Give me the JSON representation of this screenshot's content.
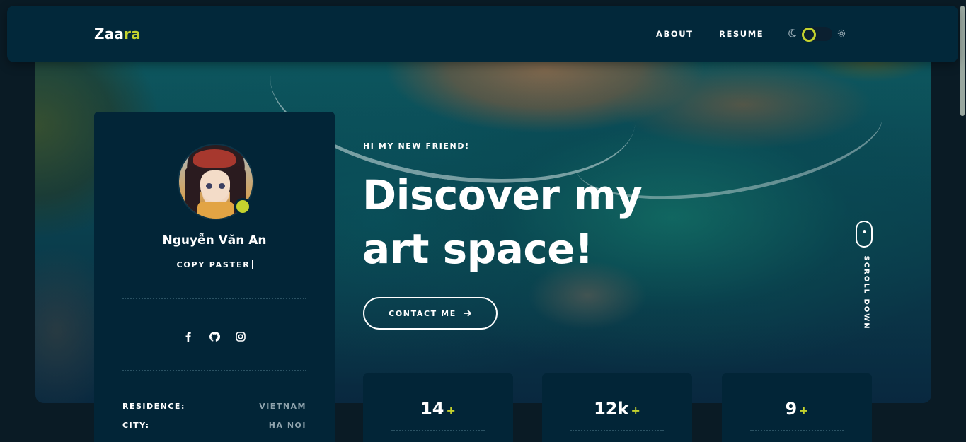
{
  "header": {
    "logo_main": "Zaa",
    "logo_accent": "ra",
    "nav": [
      {
        "label": "ABOUT"
      },
      {
        "label": "RESUME"
      }
    ],
    "theme_toggle": {
      "moon_icon": "moon-icon",
      "gear_icon": "gear-icon",
      "state": "dark"
    }
  },
  "profile": {
    "name": "Nguyễn Văn An",
    "role": "COPY PASTER",
    "socials": [
      {
        "icon": "facebook-icon"
      },
      {
        "icon": "github-icon"
      },
      {
        "icon": "instagram-icon"
      }
    ],
    "info": [
      {
        "label": "RESIDENCE:",
        "value": "VIETNAM"
      },
      {
        "label": "CITY:",
        "value": "HA NOI"
      }
    ]
  },
  "hero": {
    "kicker": "HI MY NEW FRIEND!",
    "headline_line1": "Discover my",
    "headline_line2": "art space!",
    "cta_label": "CONTACT ME",
    "scroll_label": "SCROLL DOWN"
  },
  "stats": [
    {
      "value": "14",
      "suffix": "+"
    },
    {
      "value": "12k",
      "suffix": "+"
    },
    {
      "value": "9",
      "suffix": "+"
    }
  ],
  "colors": {
    "accent": "#c4d22e",
    "panel": "#022537",
    "background": "#0a1b25"
  }
}
